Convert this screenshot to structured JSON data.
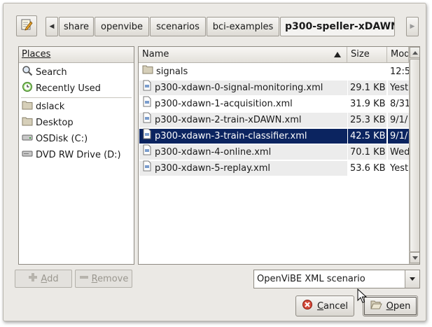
{
  "pathbar": {
    "crumbs": [
      "share",
      "openvibe",
      "scenarios",
      "bci-examples",
      "p300-speller-xDAWN"
    ]
  },
  "places": {
    "header": "Places",
    "items": [
      {
        "label": "Search",
        "icon": "search-icon"
      },
      {
        "label": "Recently Used",
        "icon": "recent-icon"
      },
      {
        "label": "dslack",
        "icon": "folder-icon"
      },
      {
        "label": "Desktop",
        "icon": "folder-icon"
      },
      {
        "label": "OSDisk (C:)",
        "icon": "drive-icon"
      },
      {
        "label": "DVD RW Drive (D:)",
        "icon": "drive-icon"
      }
    ]
  },
  "files": {
    "columns": {
      "name": "Name",
      "size": "Size",
      "modified": "Mod"
    },
    "rows": [
      {
        "name": "signals",
        "size": "",
        "modified": "12:5",
        "type": "folder"
      },
      {
        "name": "p300-xdawn-0-signal-monitoring.xml",
        "size": "29.1 KB",
        "modified": "Yest",
        "type": "file"
      },
      {
        "name": "p300-xdawn-1-acquisition.xml",
        "size": "31.9 KB",
        "modified": "8/31",
        "type": "file"
      },
      {
        "name": "p300-xdawn-2-train-xDAWN.xml",
        "size": "25.3 KB",
        "modified": "9/1/",
        "type": "file"
      },
      {
        "name": "p300-xdawn-3-train-classifier.xml",
        "size": "42.5 KB",
        "modified": "9/1/",
        "type": "file",
        "selected": true
      },
      {
        "name": "p300-xdawn-4-online.xml",
        "size": "70.1 KB",
        "modified": "Wed",
        "type": "file"
      },
      {
        "name": "p300-xdawn-5-replay.xml",
        "size": "53.6 KB",
        "modified": "Yest",
        "type": "file"
      }
    ]
  },
  "buttons": {
    "add": {
      "mnemonic": "A",
      "rest": "dd"
    },
    "remove": {
      "mnemonic": "R",
      "rest": "emove"
    },
    "cancel": {
      "mnemonic": "C",
      "rest": "ancel"
    },
    "open": {
      "mnemonic": "O",
      "rest": "pen"
    }
  },
  "filter": {
    "value": "OpenViBE XML scenario"
  },
  "colors": {
    "selection": "#0b2460",
    "dialog_bg": "#ebe9e5",
    "folder": "#c9c0a6",
    "cancel_icon": "#c0392b"
  }
}
